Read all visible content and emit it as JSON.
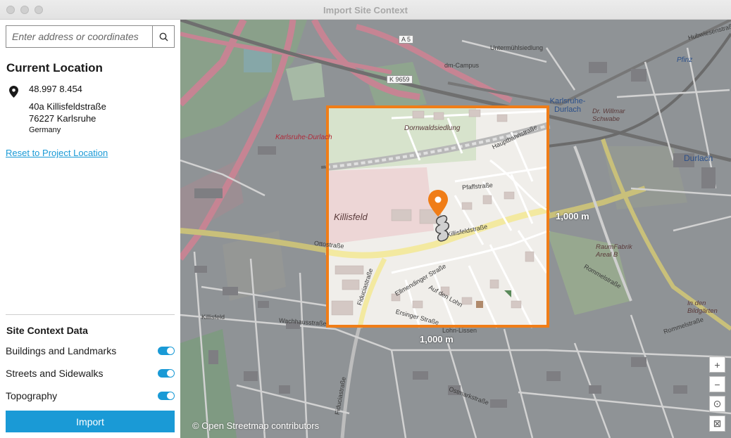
{
  "window": {
    "title": "Import Site Context"
  },
  "search": {
    "placeholder": "Enter address or coordinates",
    "button_icon": "search-icon"
  },
  "current_location": {
    "heading": "Current Location",
    "coordinates": "48.997 8.454",
    "street": "40a Killisfeldstraße",
    "city": "76227 Karlsruhe",
    "country": "Germany",
    "reset_link": "Reset to Project Location"
  },
  "site_context": {
    "heading": "Site Context Data",
    "options": [
      {
        "label": "Buildings and Landmarks",
        "enabled": true
      },
      {
        "label": "Streets and Sidewalks",
        "enabled": true
      },
      {
        "label": "Topography",
        "enabled": true
      }
    ],
    "import_label": "Import"
  },
  "map": {
    "width_label": "1,000 m",
    "height_label": "1,000 m",
    "attribution": "© Open Streetmap contributors",
    "selection_color": "#f07d17",
    "accent_color": "#1a9ad6",
    "controls": [
      {
        "name": "zoom-in",
        "icon": "+"
      },
      {
        "name": "zoom-out",
        "icon": "−"
      },
      {
        "name": "locate",
        "icon": "⊙"
      },
      {
        "name": "fit",
        "icon": "⊠"
      }
    ],
    "labels": {
      "a5": "A 5",
      "k9659": "K 9659",
      "untermuhl": "Untermühlsiedlung",
      "dmcampus": "dm-Campus",
      "durlach_station": "Karlsruhe-Durlach",
      "durlach_town": "Durlach",
      "willmar": "Dr. Willmar Schwabe",
      "dornwald": "Dornwaldsiedlung",
      "killisfeld_big": "Killisfeld",
      "killisfeld_small": "Killisfeld",
      "killisfeldstr": "Killisfeldstraße",
      "ottostr": "Ottostraße",
      "fiduciastr": "Fiduciastraße",
      "fiduciastr2": "Fiduciastraße",
      "rommelstr": "Rommelstraße",
      "rommelstr2": "Rommelstraße",
      "raumfabrik": "RaumFabrik Areal B",
      "lohnlissen": "Lohn-Lissen",
      "kd_red": "Karlsruhe-Durlach",
      "pfaffstr": "Pfaffstraße",
      "auf_lohn": "Auf den Lohn",
      "ellmendinger": "Ellmendinger Straße",
      "ersinger": "Ersinger Straße",
      "pfinz": "Pfinz",
      "hubwiesen": "Hubwiesenstraße",
      "in_bildgarten": "In den Bildgärten",
      "ostmarkstr": "Ostmarkstraße",
      "wachhausstr": "Wachhausstraße",
      "hauptbahnstr": "Hauptbahnstraße"
    }
  }
}
